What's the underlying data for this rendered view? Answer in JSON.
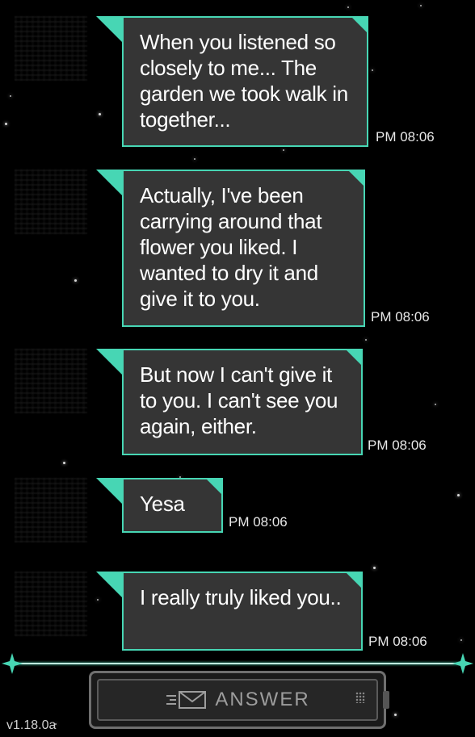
{
  "messages": [
    {
      "text": "When you listened so closely to me... The garden we took walk in together...",
      "time": "PM 08:06"
    },
    {
      "text": "Actually, I've been carrying around that flower you liked. I wanted to dry it and give it to you.",
      "time": "PM 08:06"
    },
    {
      "text": "But now I can't give it to you. I can't see you again, either.",
      "time": "PM 08:06"
    },
    {
      "text": "Yesa",
      "time": "PM 08:06"
    },
    {
      "text": "I really truly liked you..",
      "time": "PM 08:06"
    }
  ],
  "answer_button": {
    "label": "ANSWER",
    "icon": "mail-icon"
  },
  "version": "v1.18.0a",
  "colors": {
    "accent": "#47d6b4",
    "bubble": "#353535",
    "background": "#000000"
  }
}
